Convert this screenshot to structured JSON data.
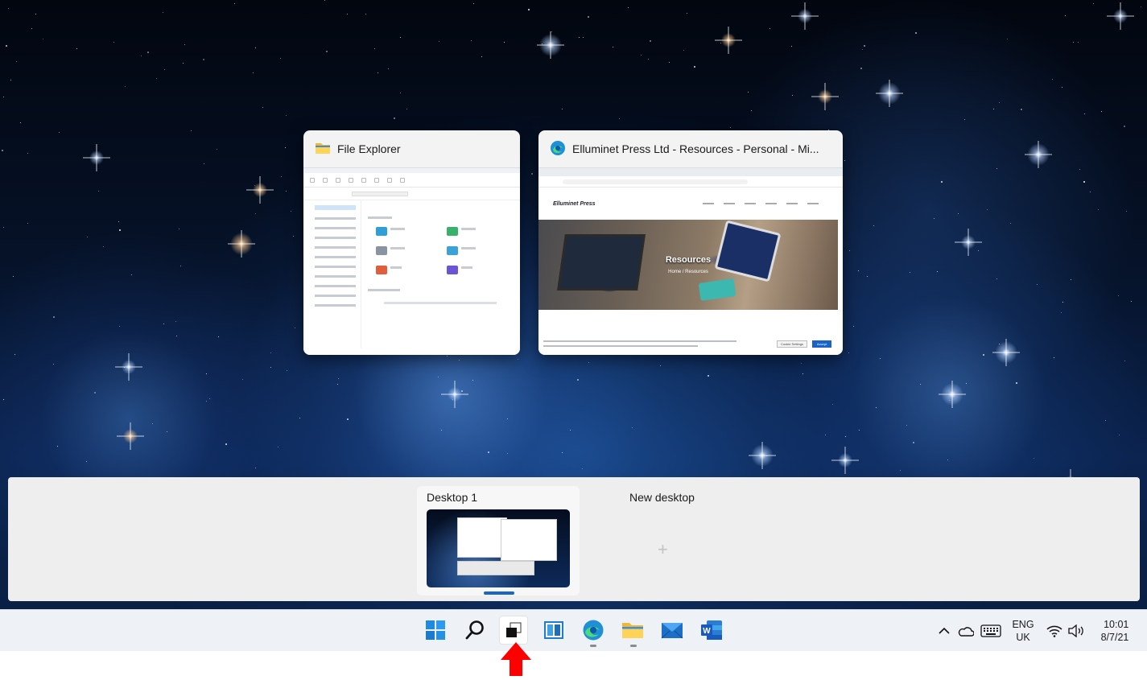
{
  "task_view": {
    "windows": [
      {
        "title": "File Explorer",
        "icon": "folder-icon"
      },
      {
        "title": "Elluminet Press Ltd - Resources - Personal - Mi...",
        "icon": "edge-icon",
        "page": {
          "logo": "Elluminet Press",
          "hero_title": "Resources",
          "hero_sub": "Home / Resources",
          "cookie_buttons": [
            "Cookie Settings",
            "Accept"
          ]
        }
      }
    ]
  },
  "desktops": {
    "items": [
      {
        "label": "Desktop 1",
        "selected": true
      },
      {
        "label": "New desktop",
        "icon": "plus-icon"
      }
    ]
  },
  "taskbar": {
    "apps": [
      "start-icon",
      "search-icon",
      "task-view-icon",
      "widgets-icon",
      "edge-icon",
      "file-explorer-icon",
      "mail-icon",
      "word-icon"
    ],
    "tray": {
      "language_line1": "ENG",
      "language_line2": "UK",
      "time": "10:01",
      "date": "8/7/21"
    }
  },
  "colors": {
    "accent": "#1866c7",
    "arrow": "#ff0000",
    "taskbar_bg": "#eef2f7"
  }
}
